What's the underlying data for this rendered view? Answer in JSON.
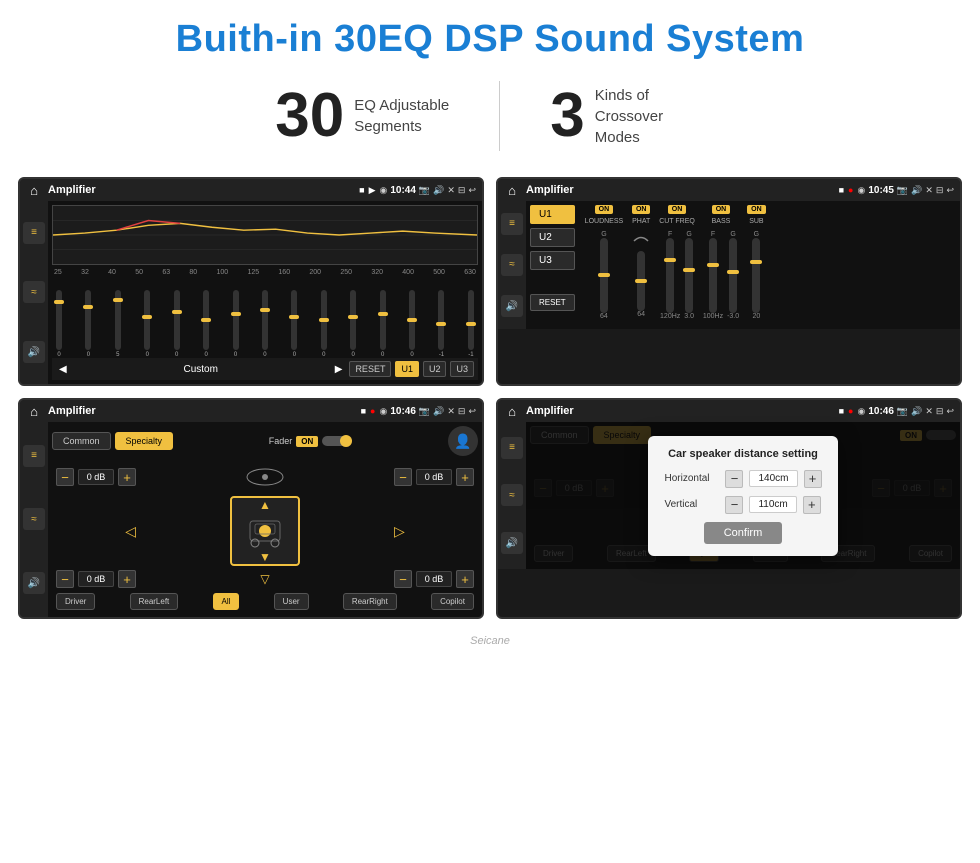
{
  "page": {
    "title": "Buith-in 30EQ DSP Sound System",
    "stat1_number": "30",
    "stat1_label": "EQ Adjustable\nSegments",
    "stat2_number": "3",
    "stat2_label": "Kinds of\nCrossover Modes"
  },
  "screen1": {
    "title": "Amplifier",
    "time": "10:44",
    "freq_labels": [
      "25",
      "32",
      "40",
      "50",
      "63",
      "80",
      "100",
      "125",
      "160",
      "200",
      "250",
      "320",
      "400",
      "500",
      "630"
    ],
    "preset": "Custom",
    "buttons": [
      "RESET",
      "U1",
      "U2",
      "U3"
    ]
  },
  "screen2": {
    "title": "Amplifier",
    "time": "10:45",
    "u_buttons": [
      "U1",
      "U2",
      "U3"
    ],
    "channels": [
      "LOUDNESS",
      "PHAT",
      "CUT FREQ",
      "BASS",
      "SUB"
    ],
    "channel_on": [
      true,
      true,
      true,
      true,
      true
    ]
  },
  "screen3": {
    "title": "Amplifier",
    "time": "10:46",
    "tabs": [
      "Common",
      "Specialty"
    ],
    "active_tab": "Specialty",
    "fader_label": "Fader",
    "fader_on": true,
    "db_values": [
      "0 dB",
      "0 dB",
      "0 dB",
      "0 dB"
    ],
    "bottom_buttons": [
      "Driver",
      "RearLeft",
      "All",
      "User",
      "RearRight",
      "Copilot"
    ]
  },
  "screen4": {
    "title": "Amplifier",
    "time": "10:46",
    "tabs": [
      "Common",
      "Specialty"
    ],
    "active_tab": "Specialty",
    "dialog_title": "Car speaker distance setting",
    "horizontal_label": "Horizontal",
    "horizontal_value": "140cm",
    "vertical_label": "Vertical",
    "vertical_value": "110cm",
    "confirm_label": "Confirm",
    "db_values": [
      "0 dB",
      "0 dB"
    ],
    "bottom_buttons": [
      "Driver",
      "RearLeft",
      "User",
      "RearRight",
      "Copilot"
    ]
  },
  "watermark": "Seicane"
}
